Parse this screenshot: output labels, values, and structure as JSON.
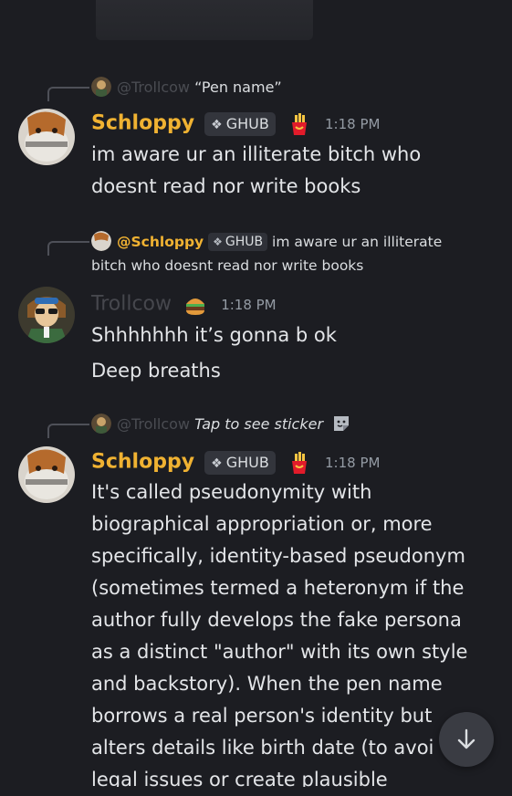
{
  "top_attachment": {
    "label": ""
  },
  "messages": [
    {
      "reply": {
        "author": "@Trollcow",
        "text": "“Pen name”"
      },
      "author": "Schloppy",
      "tag": "GHUB",
      "time": "1:18 PM",
      "lines": [
        "im aware ur an illiterate bitch who",
        "doesnt read nor write books"
      ]
    },
    {
      "reply": {
        "author": "@Schloppy",
        "tag": "GHUB",
        "text1": "im aware ur an illiterate",
        "text2": "bitch who doesnt read nor write books"
      },
      "author": "Trollcow",
      "time": "1:18 PM",
      "lines": [
        "Shhhhhhh it’s gonna b ok",
        "Deep breaths"
      ]
    },
    {
      "reply": {
        "author": "@Trollcow",
        "text": "Tap to see sticker"
      },
      "author": "Schloppy",
      "tag": "GHUB",
      "time": "1:18 PM",
      "lines": [
        "It's called pseudonymity with",
        "biographical appropriation or, more",
        "specifically, identity-based pseudonym",
        "(sometimes termed a heteronym if the",
        "author fully develops the fake persona",
        "as a distinct \"author\" with its own style",
        "and backstory). When the pen name",
        "borrows a real person's identity but",
        "alters details like birth date (to avoi",
        "legal issues or create plausible"
      ]
    }
  ],
  "icons": {
    "scroll_down": "arrow-down-icon",
    "clan_tag": "diamond-icon",
    "badge_schloppy": "fries-icon",
    "badge_trollcow": "burger-icon",
    "sticker": "sticker-icon"
  },
  "colors": {
    "background": "#1c1d22",
    "schloppy": "#f0b232",
    "trollcow": "#46474d",
    "timestamp": "#949ba4"
  }
}
